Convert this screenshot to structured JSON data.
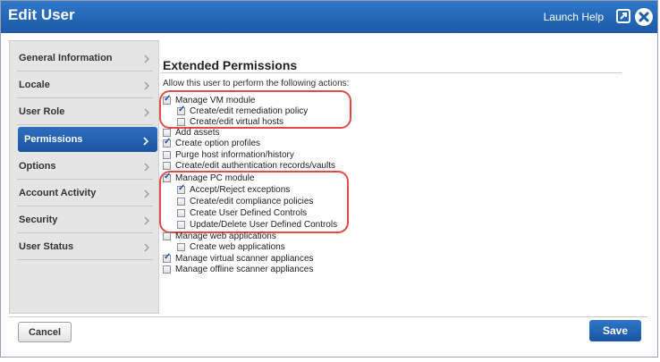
{
  "dialog": {
    "title": "Edit User",
    "help_label": "Launch Help"
  },
  "sidebar": {
    "items": [
      {
        "label": "General Information"
      },
      {
        "label": "Locale"
      },
      {
        "label": "User Role"
      },
      {
        "label": "Permissions"
      },
      {
        "label": "Options"
      },
      {
        "label": "Account Activity"
      },
      {
        "label": "Security"
      },
      {
        "label": "User Status"
      }
    ],
    "active": "Permissions"
  },
  "main": {
    "section_title": "Extended Permissions",
    "intro": "Allow this user to perform the following actions:",
    "permissions": [
      {
        "label": "Manage VM module",
        "checked": true
      },
      {
        "label": "Create/edit remediation policy",
        "checked": true
      },
      {
        "label": "Create/edit virtual hosts",
        "checked": false
      },
      {
        "label": "Add assets",
        "checked": false
      },
      {
        "label": "Create option profiles",
        "checked": true
      },
      {
        "label": "Purge host information/history",
        "checked": false
      },
      {
        "label": "Create/edit authentication records/vaults",
        "checked": false
      },
      {
        "label": "Manage PC module",
        "checked": true
      },
      {
        "label": "Accept/Reject exceptions",
        "checked": true
      },
      {
        "label": "Create/edit compliance policies",
        "checked": false
      },
      {
        "label": "Create User Defined Controls",
        "checked": false
      },
      {
        "label": "Update/Delete User Defined Controls",
        "checked": false
      },
      {
        "label": "Manage web applications",
        "checked": false
      },
      {
        "label": "Create web applications",
        "checked": false
      },
      {
        "label": "Manage virtual scanner appliances",
        "checked": true
      },
      {
        "label": "Manage offline scanner appliances",
        "checked": false
      }
    ]
  },
  "footer": {
    "cancel_label": "Cancel",
    "save_label": "Save"
  },
  "colors": {
    "accent": "#1d5ba8",
    "highlight": "#e04b4b"
  }
}
